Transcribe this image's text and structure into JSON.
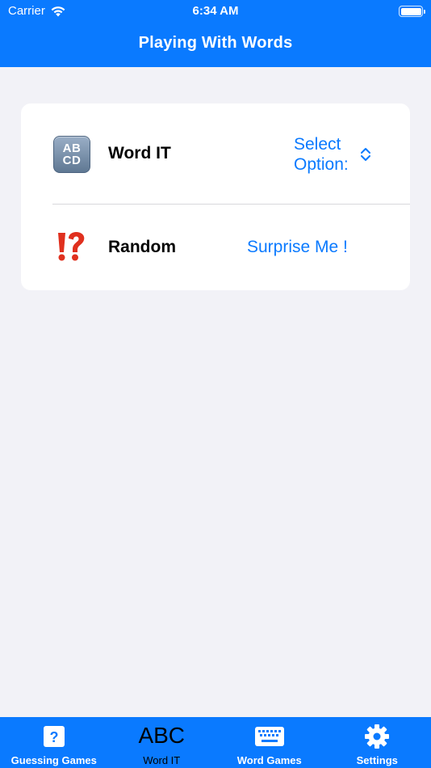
{
  "status_bar": {
    "carrier": "Carrier",
    "time": "6:34 AM"
  },
  "nav": {
    "title": "Playing With Words"
  },
  "rows": [
    {
      "icon": "abcd-icon",
      "icon_text": [
        "AB",
        "CD"
      ],
      "label": "Word IT",
      "action_label": "Select Option:"
    },
    {
      "icon": "interrobang-icon",
      "label": "Random",
      "action_label": "Surprise Me !"
    }
  ],
  "tabs": [
    {
      "label": "Guessing Games",
      "icon": "question-icon"
    },
    {
      "label": "Word IT",
      "icon": "abc-icon",
      "icon_text": "ABC",
      "active": true
    },
    {
      "label": "Word Games",
      "icon": "keyboard-icon"
    },
    {
      "label": "Settings",
      "icon": "gear-icon"
    }
  ],
  "colors": {
    "accent": "#0a7aff",
    "background": "#f2f2f7",
    "card": "#ffffff",
    "interrobang": "#e0301e"
  }
}
